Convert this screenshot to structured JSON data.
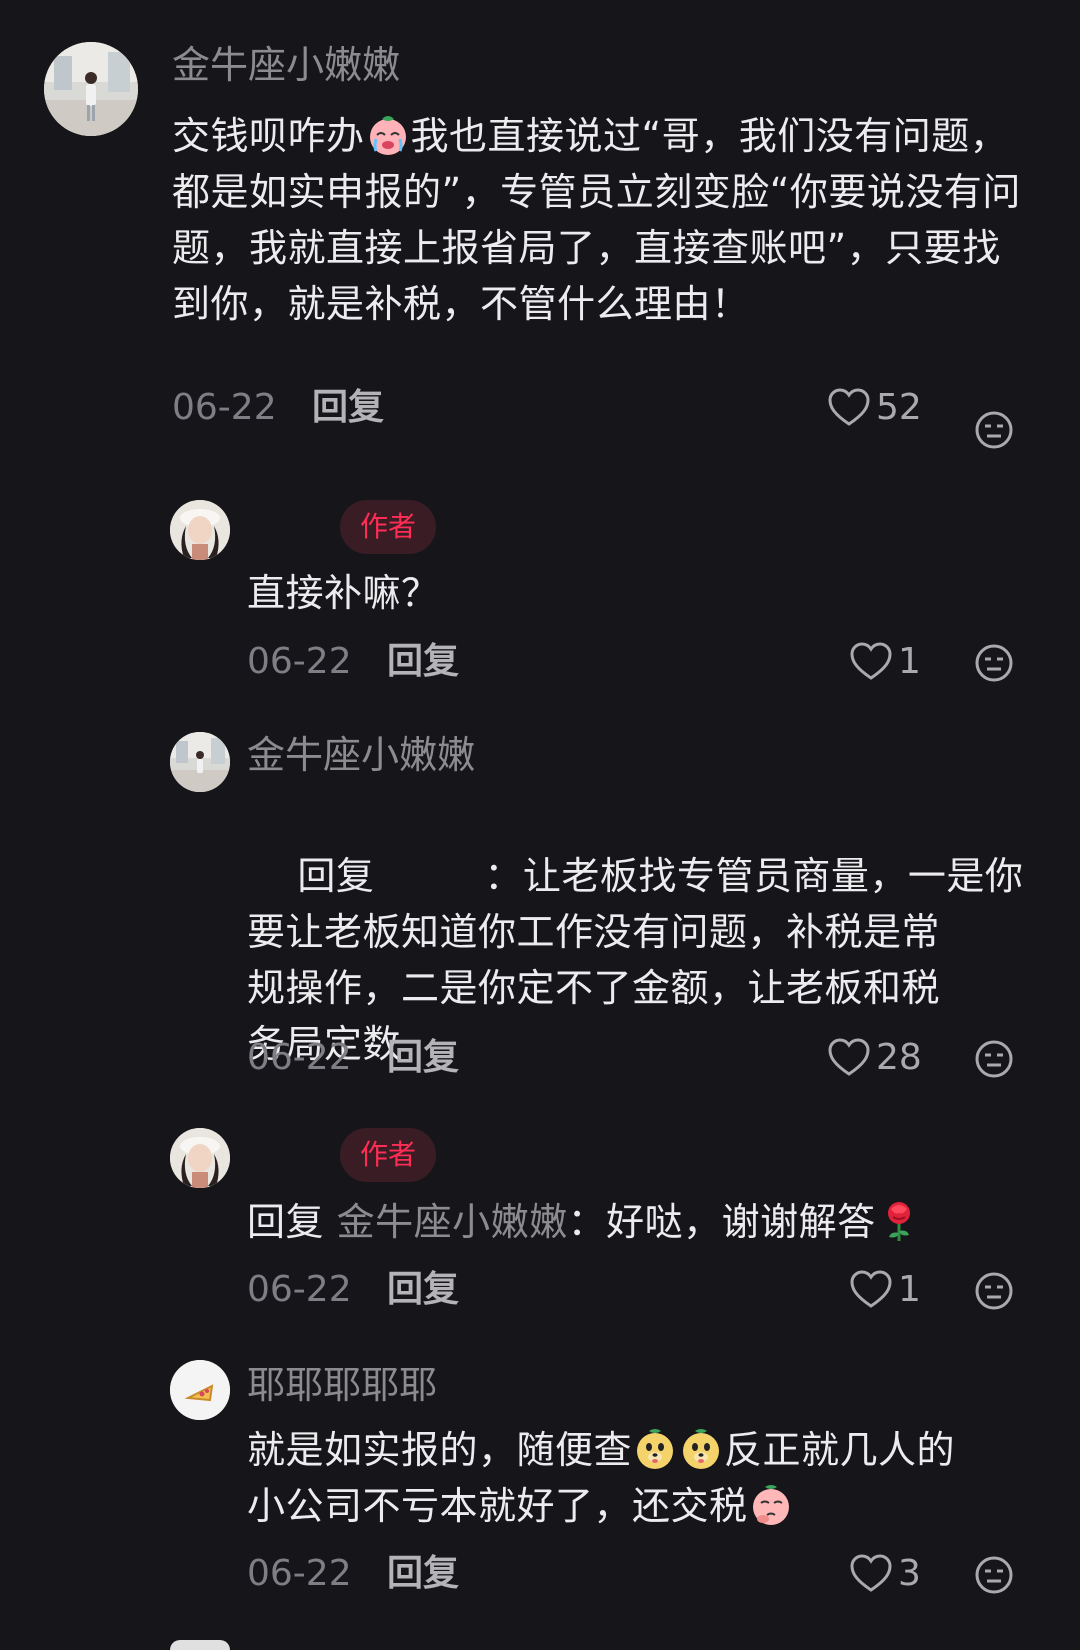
{
  "colors": {
    "background": "#16161a",
    "text_primary": "#ececee",
    "text_secondary": "#8b8b90",
    "author_badge_bg": "#3a1d24",
    "author_badge_text": "#ff2d55"
  },
  "author_badge_label": "作者",
  "comments": [
    {
      "username": "金牛座小嫩嫩",
      "text_parts": [
        "交钱呗咋办",
        "我也直接说过“哥，我们没有问题，都是如实申报的”，专管员立刻变脸“你要说没有问题，我就直接上报省局了，直接查账吧”，只要找到你，就是补税，不管什么理由！"
      ],
      "emoji": "crying-face-emoji",
      "date": "06-22",
      "reply_label": "回复",
      "likes": "52"
    },
    {
      "username": "",
      "is_author": true,
      "text": "直接补嘛？",
      "date": "06-22",
      "reply_label": "回复",
      "likes": "1"
    },
    {
      "username": "金牛座小嫩嫩",
      "reply_prefix": "回复",
      "text_lines": [
        "：让老板找专管员商量，一是你",
        "要让老板知道你工作没有问题，补税是常",
        "规操作，二是你定不了金额，让老板和税",
        "务局定数"
      ],
      "date": "06-22",
      "reply_label": "回复",
      "likes": "28"
    },
    {
      "username": "",
      "is_author": true,
      "reply_prefix": "回复",
      "mention": "金牛座小嫩嫩",
      "text": "：好哒，谢谢解答",
      "emoji": "rose-emoji",
      "date": "06-22",
      "reply_label": "回复",
      "likes": "1"
    },
    {
      "username": "耶耶耶耶耶",
      "text_parts": [
        "就是如实报的，随便查",
        "反正就几人的",
        "小公司不亏本就好了，还交税"
      ],
      "emojis": [
        "dog-face-emoji",
        "dog-face-emoji",
        "thinking-peach-emoji"
      ],
      "date": "06-22",
      "reply_label": "回复",
      "likes": "3"
    }
  ]
}
